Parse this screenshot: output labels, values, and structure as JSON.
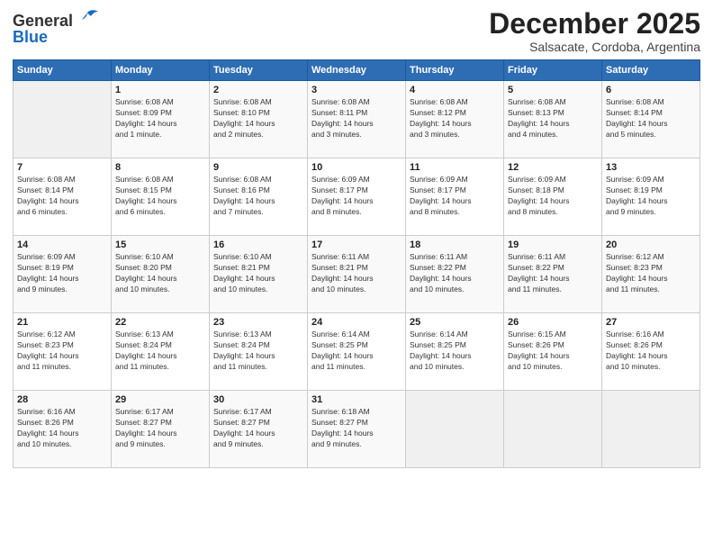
{
  "logo": {
    "general": "General",
    "blue": "Blue"
  },
  "title": "December 2025",
  "subtitle": "Salsacate, Cordoba, Argentina",
  "days_header": [
    "Sunday",
    "Monday",
    "Tuesday",
    "Wednesday",
    "Thursday",
    "Friday",
    "Saturday"
  ],
  "weeks": [
    [
      {
        "day": "",
        "info": ""
      },
      {
        "day": "1",
        "info": "Sunrise: 6:08 AM\nSunset: 8:09 PM\nDaylight: 14 hours\nand 1 minute."
      },
      {
        "day": "2",
        "info": "Sunrise: 6:08 AM\nSunset: 8:10 PM\nDaylight: 14 hours\nand 2 minutes."
      },
      {
        "day": "3",
        "info": "Sunrise: 6:08 AM\nSunset: 8:11 PM\nDaylight: 14 hours\nand 3 minutes."
      },
      {
        "day": "4",
        "info": "Sunrise: 6:08 AM\nSunset: 8:12 PM\nDaylight: 14 hours\nand 3 minutes."
      },
      {
        "day": "5",
        "info": "Sunrise: 6:08 AM\nSunset: 8:13 PM\nDaylight: 14 hours\nand 4 minutes."
      },
      {
        "day": "6",
        "info": "Sunrise: 6:08 AM\nSunset: 8:14 PM\nDaylight: 14 hours\nand 5 minutes."
      }
    ],
    [
      {
        "day": "7",
        "info": "Sunrise: 6:08 AM\nSunset: 8:14 PM\nDaylight: 14 hours\nand 6 minutes."
      },
      {
        "day": "8",
        "info": "Sunrise: 6:08 AM\nSunset: 8:15 PM\nDaylight: 14 hours\nand 6 minutes."
      },
      {
        "day": "9",
        "info": "Sunrise: 6:08 AM\nSunset: 8:16 PM\nDaylight: 14 hours\nand 7 minutes."
      },
      {
        "day": "10",
        "info": "Sunrise: 6:09 AM\nSunset: 8:17 PM\nDaylight: 14 hours\nand 8 minutes."
      },
      {
        "day": "11",
        "info": "Sunrise: 6:09 AM\nSunset: 8:17 PM\nDaylight: 14 hours\nand 8 minutes."
      },
      {
        "day": "12",
        "info": "Sunrise: 6:09 AM\nSunset: 8:18 PM\nDaylight: 14 hours\nand 8 minutes."
      },
      {
        "day": "13",
        "info": "Sunrise: 6:09 AM\nSunset: 8:19 PM\nDaylight: 14 hours\nand 9 minutes."
      }
    ],
    [
      {
        "day": "14",
        "info": "Sunrise: 6:09 AM\nSunset: 8:19 PM\nDaylight: 14 hours\nand 9 minutes."
      },
      {
        "day": "15",
        "info": "Sunrise: 6:10 AM\nSunset: 8:20 PM\nDaylight: 14 hours\nand 10 minutes."
      },
      {
        "day": "16",
        "info": "Sunrise: 6:10 AM\nSunset: 8:21 PM\nDaylight: 14 hours\nand 10 minutes."
      },
      {
        "day": "17",
        "info": "Sunrise: 6:11 AM\nSunset: 8:21 PM\nDaylight: 14 hours\nand 10 minutes."
      },
      {
        "day": "18",
        "info": "Sunrise: 6:11 AM\nSunset: 8:22 PM\nDaylight: 14 hours\nand 10 minutes."
      },
      {
        "day": "19",
        "info": "Sunrise: 6:11 AM\nSunset: 8:22 PM\nDaylight: 14 hours\nand 11 minutes."
      },
      {
        "day": "20",
        "info": "Sunrise: 6:12 AM\nSunset: 8:23 PM\nDaylight: 14 hours\nand 11 minutes."
      }
    ],
    [
      {
        "day": "21",
        "info": "Sunrise: 6:12 AM\nSunset: 8:23 PM\nDaylight: 14 hours\nand 11 minutes."
      },
      {
        "day": "22",
        "info": "Sunrise: 6:13 AM\nSunset: 8:24 PM\nDaylight: 14 hours\nand 11 minutes."
      },
      {
        "day": "23",
        "info": "Sunrise: 6:13 AM\nSunset: 8:24 PM\nDaylight: 14 hours\nand 11 minutes."
      },
      {
        "day": "24",
        "info": "Sunrise: 6:14 AM\nSunset: 8:25 PM\nDaylight: 14 hours\nand 11 minutes."
      },
      {
        "day": "25",
        "info": "Sunrise: 6:14 AM\nSunset: 8:25 PM\nDaylight: 14 hours\nand 10 minutes."
      },
      {
        "day": "26",
        "info": "Sunrise: 6:15 AM\nSunset: 8:26 PM\nDaylight: 14 hours\nand 10 minutes."
      },
      {
        "day": "27",
        "info": "Sunrise: 6:16 AM\nSunset: 8:26 PM\nDaylight: 14 hours\nand 10 minutes."
      }
    ],
    [
      {
        "day": "28",
        "info": "Sunrise: 6:16 AM\nSunset: 8:26 PM\nDaylight: 14 hours\nand 10 minutes."
      },
      {
        "day": "29",
        "info": "Sunrise: 6:17 AM\nSunset: 8:27 PM\nDaylight: 14 hours\nand 9 minutes."
      },
      {
        "day": "30",
        "info": "Sunrise: 6:17 AM\nSunset: 8:27 PM\nDaylight: 14 hours\nand 9 minutes."
      },
      {
        "day": "31",
        "info": "Sunrise: 6:18 AM\nSunset: 8:27 PM\nDaylight: 14 hours\nand 9 minutes."
      },
      {
        "day": "",
        "info": ""
      },
      {
        "day": "",
        "info": ""
      },
      {
        "day": "",
        "info": ""
      }
    ]
  ]
}
